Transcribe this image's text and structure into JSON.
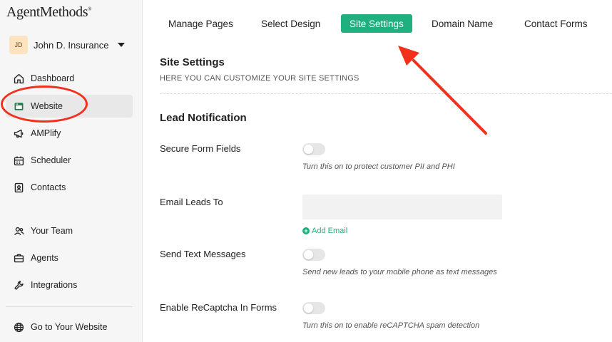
{
  "brand": {
    "logo_text": "AgentMethods",
    "logo_mark": "®"
  },
  "account": {
    "initials": "JD",
    "name": "John D. Insurance"
  },
  "sidebar": {
    "items": [
      {
        "label": "Dashboard",
        "icon": "home-icon"
      },
      {
        "label": "Website",
        "icon": "browser-icon",
        "active": true
      },
      {
        "label": "AMPlify",
        "icon": "megaphone-icon"
      },
      {
        "label": "Scheduler",
        "icon": "calendar-icon"
      },
      {
        "label": "Contacts",
        "icon": "contact-card-icon"
      },
      {
        "label": "Your Team",
        "icon": "team-icon"
      },
      {
        "label": "Agents",
        "icon": "briefcase-icon"
      },
      {
        "label": "Integrations",
        "icon": "wrench-icon"
      },
      {
        "label": "Go to Your Website",
        "icon": "globe-icon"
      }
    ]
  },
  "tabs": [
    {
      "label": "Manage Pages"
    },
    {
      "label": "Select Design"
    },
    {
      "label": "Site Settings",
      "active": true
    },
    {
      "label": "Domain Name"
    },
    {
      "label": "Contact Forms"
    }
  ],
  "site_settings": {
    "title": "Site Settings",
    "subtitle": "HERE YOU CAN CUSTOMIZE YOUR SITE SETTINGS"
  },
  "lead_notification": {
    "title": "Lead Notification",
    "secure_form_fields": {
      "label": "Secure Form Fields",
      "help": "Turn this on to protect customer PII and PHI",
      "enabled": false
    },
    "email_leads_to": {
      "label": "Email Leads To",
      "value": "",
      "add_label": "Add Email"
    },
    "send_text_messages": {
      "label": "Send Text Messages",
      "help": "Send new leads to your mobile phone as text messages",
      "enabled": false
    },
    "recaptcha": {
      "label": "Enable ReCaptcha In Forms",
      "help": "Turn this on to enable reCAPTCHA spam detection",
      "enabled": false
    }
  },
  "colors": {
    "accent": "#1fb07f",
    "annotation": "#f2301b",
    "sidebar_bg": "#f6f6f6"
  }
}
